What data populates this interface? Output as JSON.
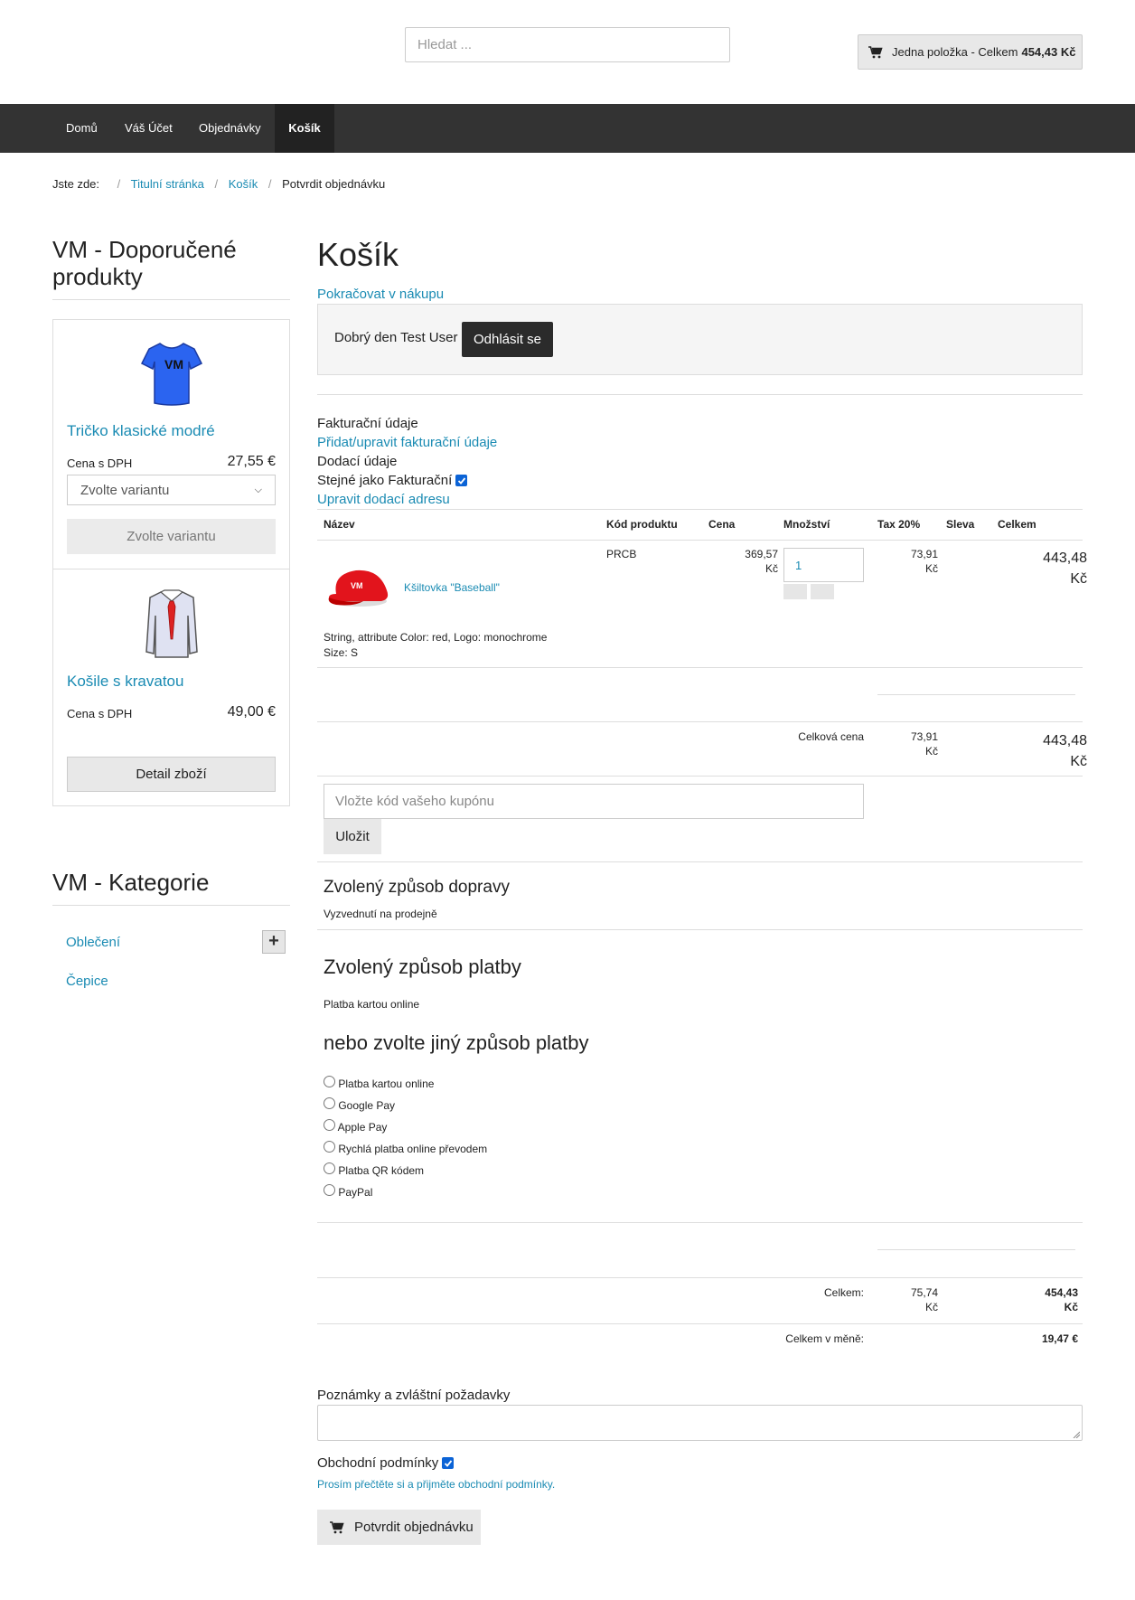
{
  "header": {
    "search_placeholder": "Hledat ...",
    "cart_text": "Jedna položka - Celkem",
    "cart_total": "454,43 Kč"
  },
  "nav": {
    "items": [
      {
        "label": "Domů"
      },
      {
        "label": "Váš Účet"
      },
      {
        "label": "Objednávky"
      },
      {
        "label": "Košík",
        "active": true
      }
    ]
  },
  "breadcrumb": {
    "prefix": "Jste zde:",
    "sep": "/",
    "items": [
      "Titulní stránka",
      "Košík",
      "Potvrdit objednávku"
    ]
  },
  "sidebar": {
    "featured_title": "VM - Doporučené produkty",
    "products": [
      {
        "name": "Tričko klasické modré",
        "price_label": "Cena s DPH",
        "price": "27,55 €",
        "select_value": "Zvolte variantu",
        "button": "Zvolte variantu",
        "image_icon": "blue-tshirt-icon"
      },
      {
        "name": "Košile s kravatou",
        "price_label": "Cena s DPH",
        "price": "49,00 €",
        "button": "Detail zboží",
        "image_icon": "shirt-tie-icon"
      }
    ],
    "categories_title": "VM - Kategorie",
    "categories": [
      "Oblečení",
      "Čepice"
    ],
    "expand_label": "+"
  },
  "main": {
    "title": "Košík",
    "continue_link": "Pokračovat v nákupu",
    "greeting": "Dobrý den Test User",
    "logout": "Odhlásit se",
    "billing_label": "Fakturační údaje",
    "billing_link": "Přidat/upravit fakturační údaje",
    "shipping_label": "Dodací údaje",
    "same_as_billing": "Stejné jako Fakturační",
    "shipping_link": "Upravit dodací adresu",
    "table": {
      "headers": [
        "Název",
        "Kód produktu",
        "Cena",
        "Množství",
        "Tax 20%",
        "Sleva",
        "Celkem"
      ],
      "row": {
        "name": "Kšiltovka \"Baseball\"",
        "code": "PRCB",
        "price_1": "369,57",
        "price_2": "Kč",
        "qty": "1",
        "tax_1": "73,91",
        "tax_2": "Kč",
        "total_1": "443,48",
        "total_2": "Kč",
        "attr_1": "String, attribute Color: red, Logo: monochrome",
        "attr_2": "Size: S",
        "image_icon": "red-cap-icon"
      },
      "subtotal_label": "Celková cena",
      "subtotal_tax_1": "73,91",
      "subtotal_tax_2": "Kč",
      "subtotal_total_1": "443,48",
      "subtotal_total_2": "Kč"
    },
    "coupon_placeholder": "Vložte kód vašeho kupónu",
    "coupon_save": "Uložit",
    "shipping_method_title": "Zvolený způsob dopravy",
    "shipping_method": "Vyzvednutí na prodejně",
    "payment_title": "Zvolený způsob platby",
    "payment_method": "Platba kartou online",
    "payment_alt_title": "nebo zvolte jiný způsob platby",
    "payment_options": [
      "Platba kartou online",
      "Google Pay",
      "Apple Pay",
      "Rychlá platba online převodem",
      "Platba QR kódem",
      "PayPal"
    ],
    "totals": {
      "label": "Celkem:",
      "tax_1": "75,74",
      "tax_2": "Kč",
      "total_1": "454,43",
      "total_2": "Kč",
      "currency_label": "Celkem v měně:",
      "currency_value": "19,47 €"
    },
    "notes_label": "Poznámky a zvláštní požadavky",
    "tos_label": "Obchodní podmínky",
    "tos_link": "Prosím přečtěte si a přijměte obchodní podmínky.",
    "confirm": "Potvrdit objednávku"
  },
  "colors": {
    "link": "#1a8bb3",
    "navbar": "#333333",
    "checkbox": "#0b63d6"
  }
}
